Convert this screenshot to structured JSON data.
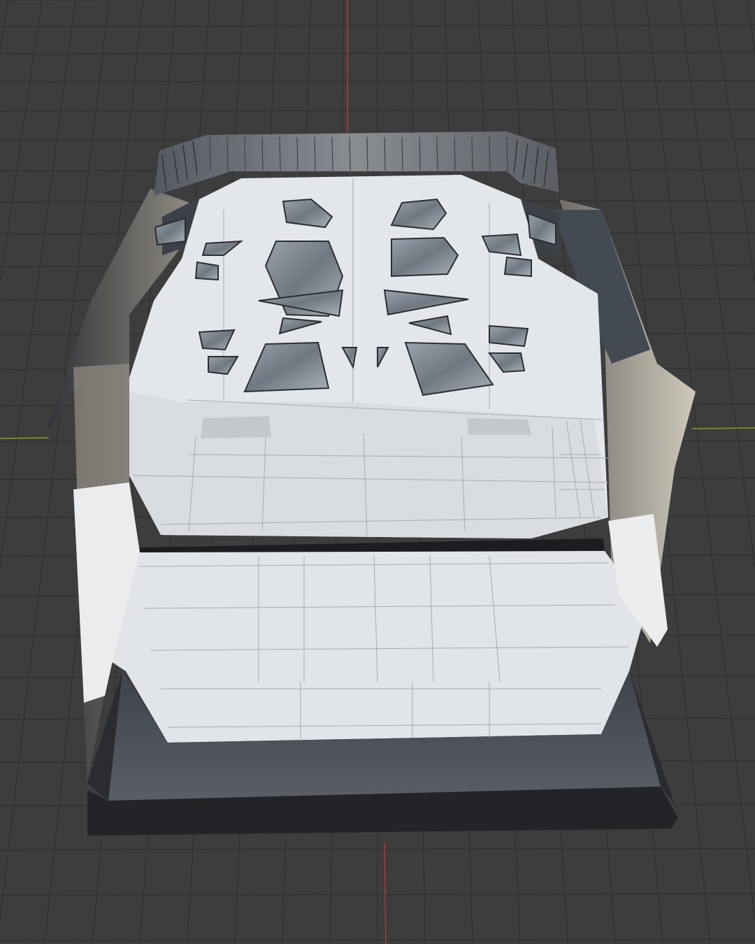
{
  "viewport": {
    "background": "#3d3d3d",
    "grid_color": "#2c2c2c",
    "x_axis_color": "#7a9a3a",
    "y_axis_color": "#b03a3a"
  },
  "model": {
    "hull_light": "#e6e8ec",
    "hull_mid": "#cfd3d9",
    "side_dark": "#4b5058",
    "side_warm": "#a9a398",
    "cutout": "#8e969f",
    "rim": "#2b2d31"
  }
}
